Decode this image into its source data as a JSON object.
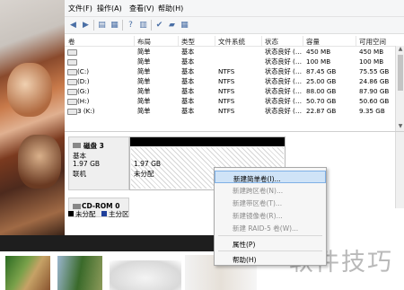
{
  "menubar": {
    "items": [
      "文件(F)",
      "操作(A)",
      "查看(V)",
      "帮助(H)"
    ]
  },
  "columns": [
    "卷",
    "布局",
    "类型",
    "文件系统",
    "状态",
    "容量",
    "可用空间"
  ],
  "volumes": [
    {
      "name": "",
      "layout": "简单",
      "type": "基本",
      "fs": "",
      "status": "状态良好 (…",
      "capacity": "450 MB",
      "free": "450 MB"
    },
    {
      "name": "",
      "layout": "简单",
      "type": "基本",
      "fs": "",
      "status": "状态良好 (…",
      "capacity": "100 MB",
      "free": "100 MB"
    },
    {
      "name": "(C:)",
      "layout": "简单",
      "type": "基本",
      "fs": "NTFS",
      "status": "状态良好 (…",
      "capacity": "87.45 GB",
      "free": "75.55 GB"
    },
    {
      "name": "(D:)",
      "layout": "简单",
      "type": "基本",
      "fs": "NTFS",
      "status": "状态良好 (…",
      "capacity": "25.00 GB",
      "free": "24.86 GB"
    },
    {
      "name": "(G:)",
      "layout": "简单",
      "type": "基本",
      "fs": "NTFS",
      "status": "状态良好 (…",
      "capacity": "88.00 GB",
      "free": "87.90 GB"
    },
    {
      "name": "(H:)",
      "layout": "简单",
      "type": "基本",
      "fs": "NTFS",
      "status": "状态良好 (…",
      "capacity": "50.70 GB",
      "free": "50.60 GB"
    },
    {
      "name": "3 (K:)",
      "layout": "简单",
      "type": "基本",
      "fs": "NTFS",
      "status": "状态良好 (…",
      "capacity": "22.87 GB",
      "free": "9.35 GB"
    }
  ],
  "disk": {
    "name": "磁盘 3",
    "type": "基本",
    "size": "1.97 GB",
    "state": "联机",
    "partition_size": "1.97 GB",
    "partition_state": "未分配"
  },
  "cdrom": {
    "name": "CD-ROM 0"
  },
  "legend": {
    "unallocated": "未分配",
    "primary": "主分区"
  },
  "context_menu": {
    "items": [
      {
        "label": "新建简单卷(I)...",
        "enabled": true,
        "highlighted": true
      },
      {
        "label": "新建跨区卷(N)...",
        "enabled": false
      },
      {
        "label": "新建带区卷(T)...",
        "enabled": false
      },
      {
        "label": "新建镜像卷(R)...",
        "enabled": false
      },
      {
        "label": "新建 RAID-5 卷(W)...",
        "enabled": false
      },
      {
        "label": "属性(P)",
        "enabled": true
      },
      {
        "label": "帮助(H)",
        "enabled": true
      }
    ]
  },
  "watermark": "软件技巧",
  "colors": {
    "highlight": "#cfe3f7",
    "primary_partition": "#1f3f9a",
    "unallocated": "#000000"
  }
}
